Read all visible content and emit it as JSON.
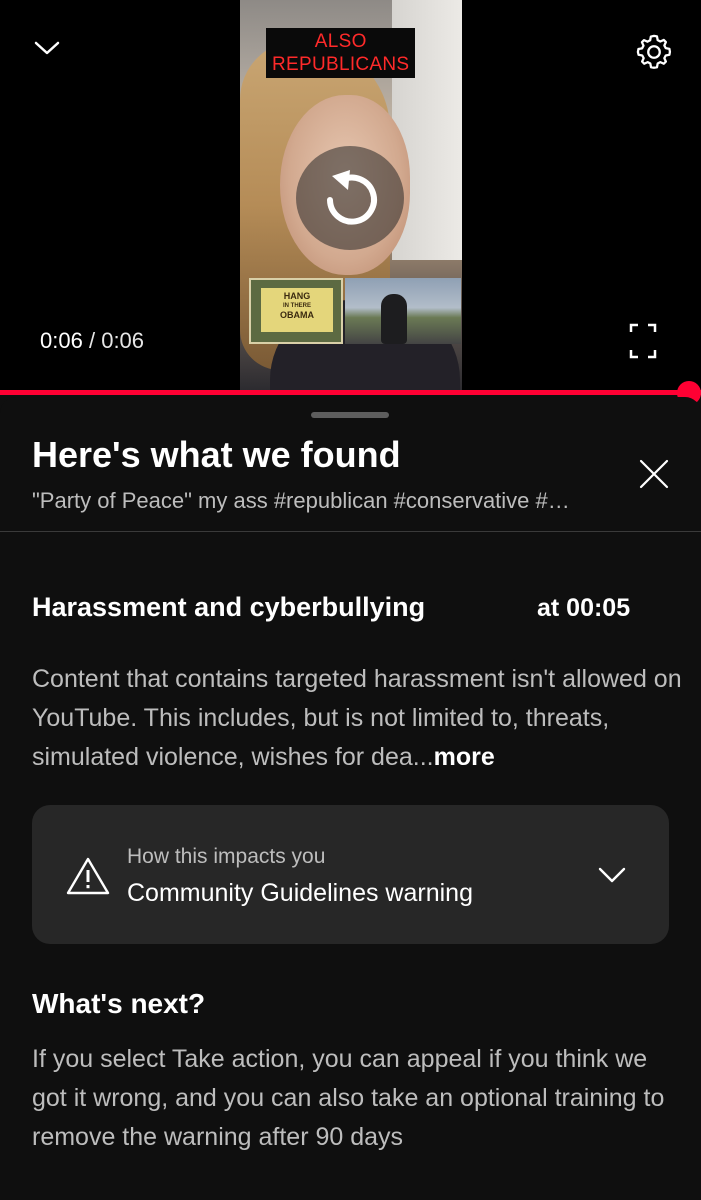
{
  "player": {
    "overlay_caption_line1": "ALSO",
    "overlay_caption_line2": "REPUBLICANS",
    "sign_text_line1": "HANG",
    "sign_text_line2": "IN THERE",
    "sign_text_line3": "OBAMA",
    "current_time": "0:06",
    "separator": "/",
    "duration": "0:06",
    "progress_fraction": 1.0,
    "accent_color": "#ff0033",
    "icons": [
      "chevron-down-icon",
      "settings-gear-icon",
      "replay-icon",
      "fullscreen-icon"
    ]
  },
  "sheet": {
    "title": "Here's what we found",
    "subtitle": "\"Party of Peace\" my ass #republican #conservative #…",
    "policy": {
      "name": "Harassment and cyberbullying",
      "timestamp": "at 00:05",
      "description": "Content that contains targeted harassment isn't allowed on YouTube. This includes, but is not limited to, threats, simulated violence, wishes for dea...",
      "more_label": "more"
    },
    "impact": {
      "label": "How this impacts you",
      "value": "Community Guidelines warning"
    },
    "next": {
      "title": "What's next?",
      "body": "If you select Take action, you can appeal if you think we got it wrong, and you can also take an optional training to remove the warning after 90 days"
    }
  }
}
